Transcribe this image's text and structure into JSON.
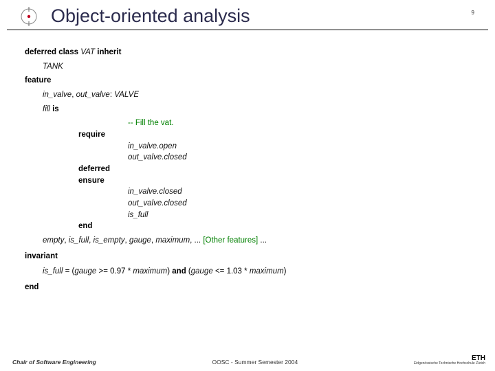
{
  "header": {
    "title": "Object-oriented analysis",
    "page_number": "9"
  },
  "code": {
    "line1_kw1": "deferred class",
    "line1_name": "VAT",
    "line1_kw2": "inherit",
    "parent": "TANK",
    "feature_kw": "feature",
    "valves_decl": "in_valve",
    "valves_sep": ", ",
    "valves_decl2": "out_valve",
    "valves_type_sep": ": ",
    "valves_type": "VALVE",
    "fill_name": "fill",
    "fill_is": " is",
    "comment": "-- Fill the vat.",
    "require_kw": "require",
    "pre1": "in_valve.open",
    "pre2": "out_valve.closed",
    "deferred_kw": "deferred",
    "ensure_kw": "ensure",
    "post1": "in_valve.closed",
    "post2": "out_valve.closed",
    "post3": "is_full",
    "end_kw": "end",
    "other_features_prefix_1": "empty",
    "sep": ", ",
    "other_features_prefix_2": "is_full",
    "other_features_prefix_3": "is_empty",
    "other_features_prefix_4": "gauge",
    "other_features_prefix_5": "maximum",
    "other_features_ellipsis": ", ... ",
    "other_features_bracket": "[Other features]",
    "other_features_trail": " ...",
    "invariant_kw": "invariant",
    "inv_lhs": "is_full",
    "inv_eq": " = (",
    "inv_p1": "gauge",
    "inv_op1": " >= 0.97 * ",
    "inv_p2": "maximum",
    "inv_close1": ")  ",
    "inv_and": "and",
    "inv_open2": "  (",
    "inv_p3": "gauge",
    "inv_op2": " <= 1.03 * ",
    "inv_p4": "maximum",
    "inv_close2": ")",
    "final_end": "end"
  },
  "footer": {
    "chair": "Chair of Software Engineering",
    "course": "OOSC - Summer Semester 2004",
    "org": "ETH",
    "org_sub": "Eidgenössische Technische Hochschule Zürich"
  }
}
